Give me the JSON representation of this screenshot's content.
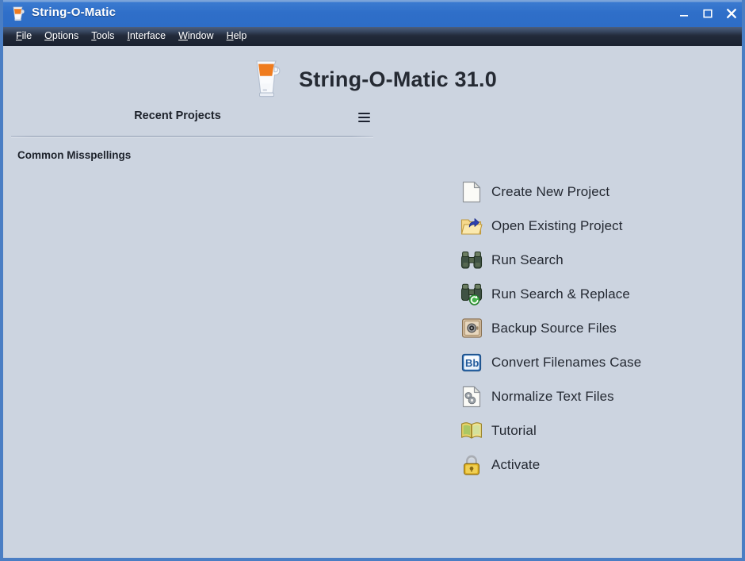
{
  "window": {
    "title": "String-O-Matic",
    "app_icon": "blender-icon",
    "controls": {
      "minimize": "minimize-icon",
      "maximize": "maximize-icon",
      "close": "close-icon"
    },
    "colors": {
      "titlebar": "#2e6dc6",
      "titlebar_highlight": "#7ba4da",
      "menubar": "#1b2230",
      "client_background": "#ccd4e0",
      "frame_border": "#4a7ec4",
      "text_primary": "#242932",
      "close_glyph": "#ffffff"
    }
  },
  "menubar": {
    "items": [
      {
        "label": "File",
        "mnemonic": "F"
      },
      {
        "label": "Options",
        "mnemonic": "O"
      },
      {
        "label": "Tools",
        "mnemonic": "T"
      },
      {
        "label": "Interface",
        "mnemonic": "I"
      },
      {
        "label": "Window",
        "mnemonic": "W"
      },
      {
        "label": "Help",
        "mnemonic": "H"
      }
    ]
  },
  "branding": {
    "logo": "blender-logo",
    "title": "String-O-Matic 31.0"
  },
  "recent_projects": {
    "heading": "Recent Projects",
    "menu_icon": "hamburger-menu-icon",
    "items": [
      {
        "name": "Common Misspellings"
      }
    ]
  },
  "actions": {
    "items": [
      {
        "label": "Create New Project",
        "icon": "new-document-icon"
      },
      {
        "label": "Open Existing Project",
        "icon": "open-folder-icon"
      },
      {
        "label": "Run Search",
        "icon": "binoculars-icon"
      },
      {
        "label": "Run Search & Replace",
        "icon": "binoculars-replace-icon"
      },
      {
        "label": "Backup Source Files",
        "icon": "safe-vault-icon"
      },
      {
        "label": "Convert Filenames Case",
        "icon": "letter-case-icon"
      },
      {
        "label": "Normalize Text Files",
        "icon": "document-gears-icon"
      },
      {
        "label": "Tutorial",
        "icon": "open-book-icon"
      },
      {
        "label": "Activate",
        "icon": "padlock-icon"
      }
    ]
  }
}
